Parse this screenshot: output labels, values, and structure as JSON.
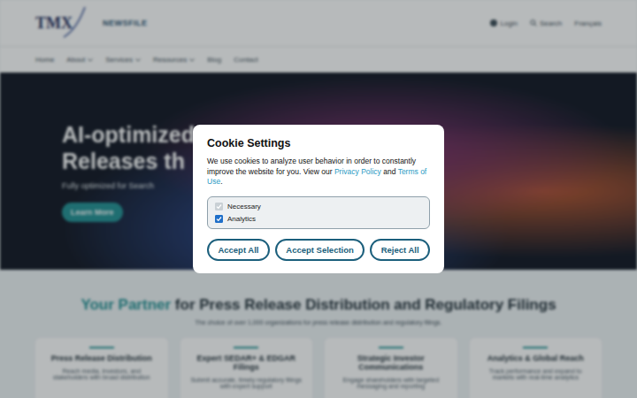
{
  "header": {
    "logo": "TMX",
    "brand": "NEWSFILE",
    "login": "Login",
    "search": "Search",
    "language": "Français"
  },
  "nav": [
    {
      "label": "Home",
      "has_menu": false
    },
    {
      "label": "About",
      "has_menu": true
    },
    {
      "label": "Services",
      "has_menu": true
    },
    {
      "label": "Resources",
      "has_menu": true
    },
    {
      "label": "Blog",
      "has_menu": false
    },
    {
      "label": "Contact",
      "has_menu": false
    }
  ],
  "hero": {
    "title_lines": [
      "AI-optimized",
      "Releases th"
    ],
    "subtitle": "Fully optimized for Search",
    "button": "Learn More"
  },
  "section": {
    "heading_accent": "Your Partner",
    "heading_rest": " for Press Release Distribution and Regulatory Filings",
    "subtitle": "The choice of over 1,000 organizations for press release distribution and regulatory filings."
  },
  "cards": [
    {
      "title": "Press Release Distribution",
      "text": "Reach media, investors, and stakeholders with broad distribution"
    },
    {
      "title": "Expert SEDAR+ & EDGAR Filings",
      "text": "Submit accurate, timely regulatory filings with expert support"
    },
    {
      "title": "Strategic Investor Communications",
      "text": "Engage shareholders with targeted messaging and reporting"
    },
    {
      "title": "Analytics & Global Reach",
      "text": "Track performance and expand to markets with real-time analytics"
    }
  ],
  "cookie": {
    "title": "Cookie Settings",
    "description": [
      {
        "text": "We use cookies to analyze user behavior in order to constantly improve the website for you. View our ",
        "link": false
      },
      {
        "text": "Privacy Policy",
        "link": true
      },
      {
        "text": " and ",
        "link": false
      },
      {
        "text": "Terms of Use",
        "link": true
      },
      {
        "text": ".",
        "link": false
      }
    ],
    "options": [
      {
        "label": "Necessary",
        "checked": true,
        "disabled": true
      },
      {
        "label": "Analytics",
        "checked": true,
        "disabled": false
      }
    ],
    "buttons": [
      "Accept All",
      "Accept Selection",
      "Reject All"
    ]
  }
}
